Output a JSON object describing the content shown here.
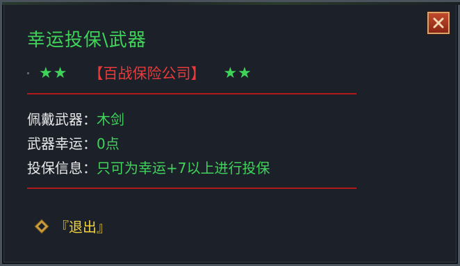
{
  "dialog": {
    "title": "幸运投保\\武器",
    "close_icon": "close-x-icon"
  },
  "header": {
    "left_stars": "★★",
    "company": "【百战保险公司】",
    "right_stars": "★★"
  },
  "info": {
    "weapon_label": "佩戴武器：",
    "weapon_value": "木剑",
    "luck_label": "武器幸运：",
    "luck_value": "0点",
    "insure_label": "投保信息：",
    "insure_value": "只可为幸运+7以上进行投保"
  },
  "actions": {
    "exit_label": "『退出』",
    "exit_icon": "diamond-icon"
  },
  "colors": {
    "title_green": "#3fd35a",
    "company_red": "#e83a3a",
    "divider_red": "#b2191b",
    "exit_yellow": "#f2d23a",
    "panel_bg": "#1c2129"
  }
}
